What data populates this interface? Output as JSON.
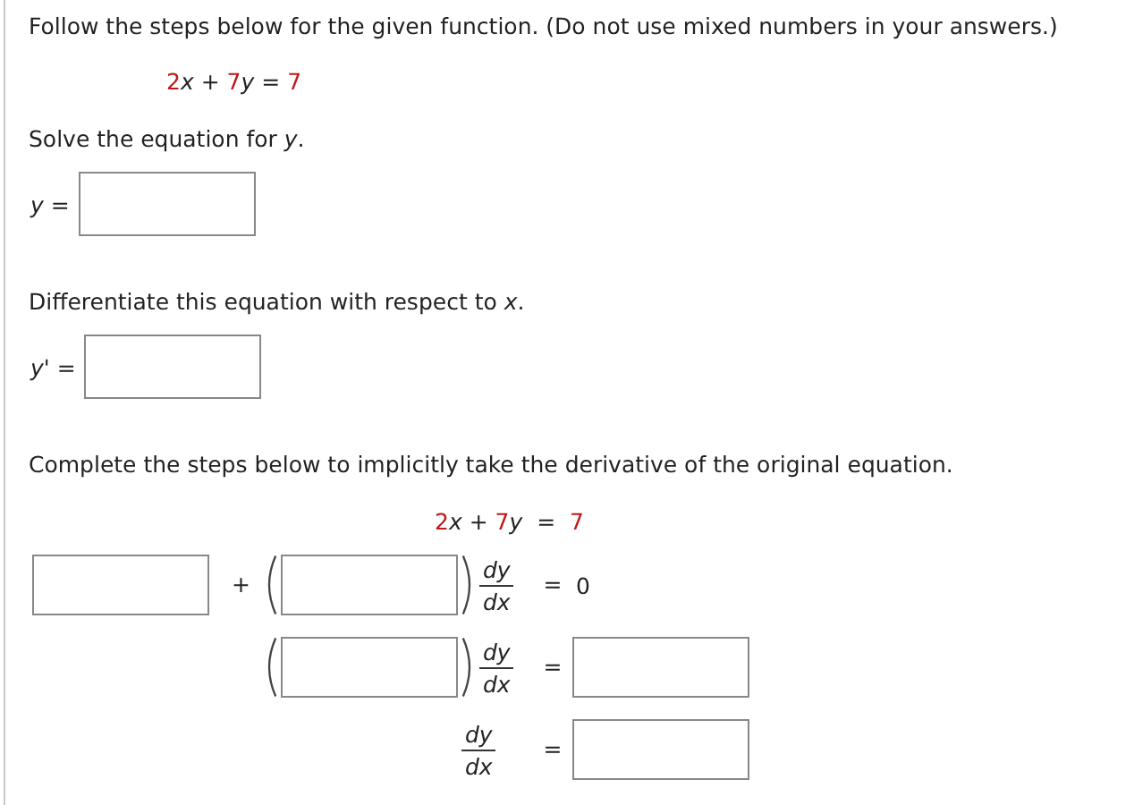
{
  "instructions": "Follow the steps below for the given function. (Do not use mixed numbers in your answers.)",
  "equation": [
    {
      "text": "2",
      "kind": "num"
    },
    {
      "text": "x",
      "kind": "var"
    },
    {
      "text": " + ",
      "kind": "op"
    },
    {
      "text": "7",
      "kind": "num"
    },
    {
      "text": "y",
      "kind": "var"
    },
    {
      "text": " = ",
      "kind": "op"
    },
    {
      "text": "7",
      "kind": "num"
    }
  ],
  "parts": [
    {
      "prompt": "Solve the equation for *y*.",
      "label": "*y* ="
    },
    {
      "prompt": "Differentiate this equation with respect to *x*.",
      "label": "*y'* ="
    }
  ],
  "implicit": {
    "prompt": "Complete the steps below to implicitly take the derivative of the original equation.",
    "equation": [
      {
        "text": "2",
        "kind": "num"
      },
      {
        "text": "x",
        "kind": "var"
      },
      {
        "text": " + ",
        "kind": "op"
      },
      {
        "text": "7",
        "kind": "num"
      },
      {
        "text": "y",
        "kind": "var"
      },
      {
        "text": "  =  ",
        "kind": "op"
      },
      {
        "text": "7",
        "kind": "num"
      }
    ],
    "rows": [
      {
        "kind": "sum",
        "plus": "+",
        "dy": "dy",
        "dx": "dx",
        "equals": "=",
        "result": "0"
      },
      {
        "kind": "product",
        "dy": "dy",
        "dx": "dx",
        "equals": "="
      },
      {
        "kind": "solution",
        "dy": "dy",
        "dx": "dx",
        "equals": "="
      }
    ]
  }
}
